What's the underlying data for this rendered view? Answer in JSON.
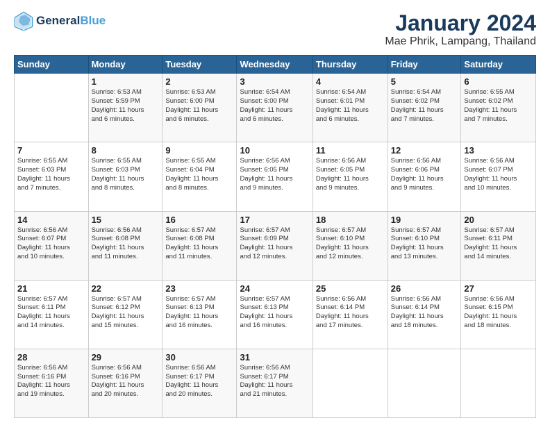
{
  "logo": {
    "line1": "General",
    "line2": "Blue"
  },
  "title": "January 2024",
  "subtitle": "Mae Phrik, Lampang, Thailand",
  "days_header": [
    "Sunday",
    "Monday",
    "Tuesday",
    "Wednesday",
    "Thursday",
    "Friday",
    "Saturday"
  ],
  "weeks": [
    [
      {
        "day": "",
        "info": ""
      },
      {
        "day": "1",
        "info": "Sunrise: 6:53 AM\nSunset: 5:59 PM\nDaylight: 11 hours\nand 6 minutes."
      },
      {
        "day": "2",
        "info": "Sunrise: 6:53 AM\nSunset: 6:00 PM\nDaylight: 11 hours\nand 6 minutes."
      },
      {
        "day": "3",
        "info": "Sunrise: 6:54 AM\nSunset: 6:00 PM\nDaylight: 11 hours\nand 6 minutes."
      },
      {
        "day": "4",
        "info": "Sunrise: 6:54 AM\nSunset: 6:01 PM\nDaylight: 11 hours\nand 6 minutes."
      },
      {
        "day": "5",
        "info": "Sunrise: 6:54 AM\nSunset: 6:02 PM\nDaylight: 11 hours\nand 7 minutes."
      },
      {
        "day": "6",
        "info": "Sunrise: 6:55 AM\nSunset: 6:02 PM\nDaylight: 11 hours\nand 7 minutes."
      }
    ],
    [
      {
        "day": "7",
        "info": "Sunrise: 6:55 AM\nSunset: 6:03 PM\nDaylight: 11 hours\nand 7 minutes."
      },
      {
        "day": "8",
        "info": "Sunrise: 6:55 AM\nSunset: 6:03 PM\nDaylight: 11 hours\nand 8 minutes."
      },
      {
        "day": "9",
        "info": "Sunrise: 6:55 AM\nSunset: 6:04 PM\nDaylight: 11 hours\nand 8 minutes."
      },
      {
        "day": "10",
        "info": "Sunrise: 6:56 AM\nSunset: 6:05 PM\nDaylight: 11 hours\nand 9 minutes."
      },
      {
        "day": "11",
        "info": "Sunrise: 6:56 AM\nSunset: 6:05 PM\nDaylight: 11 hours\nand 9 minutes."
      },
      {
        "day": "12",
        "info": "Sunrise: 6:56 AM\nSunset: 6:06 PM\nDaylight: 11 hours\nand 9 minutes."
      },
      {
        "day": "13",
        "info": "Sunrise: 6:56 AM\nSunset: 6:07 PM\nDaylight: 11 hours\nand 10 minutes."
      }
    ],
    [
      {
        "day": "14",
        "info": "Sunrise: 6:56 AM\nSunset: 6:07 PM\nDaylight: 11 hours\nand 10 minutes."
      },
      {
        "day": "15",
        "info": "Sunrise: 6:56 AM\nSunset: 6:08 PM\nDaylight: 11 hours\nand 11 minutes."
      },
      {
        "day": "16",
        "info": "Sunrise: 6:57 AM\nSunset: 6:08 PM\nDaylight: 11 hours\nand 11 minutes."
      },
      {
        "day": "17",
        "info": "Sunrise: 6:57 AM\nSunset: 6:09 PM\nDaylight: 11 hours\nand 12 minutes."
      },
      {
        "day": "18",
        "info": "Sunrise: 6:57 AM\nSunset: 6:10 PM\nDaylight: 11 hours\nand 12 minutes."
      },
      {
        "day": "19",
        "info": "Sunrise: 6:57 AM\nSunset: 6:10 PM\nDaylight: 11 hours\nand 13 minutes."
      },
      {
        "day": "20",
        "info": "Sunrise: 6:57 AM\nSunset: 6:11 PM\nDaylight: 11 hours\nand 14 minutes."
      }
    ],
    [
      {
        "day": "21",
        "info": "Sunrise: 6:57 AM\nSunset: 6:11 PM\nDaylight: 11 hours\nand 14 minutes."
      },
      {
        "day": "22",
        "info": "Sunrise: 6:57 AM\nSunset: 6:12 PM\nDaylight: 11 hours\nand 15 minutes."
      },
      {
        "day": "23",
        "info": "Sunrise: 6:57 AM\nSunset: 6:13 PM\nDaylight: 11 hours\nand 16 minutes."
      },
      {
        "day": "24",
        "info": "Sunrise: 6:57 AM\nSunset: 6:13 PM\nDaylight: 11 hours\nand 16 minutes."
      },
      {
        "day": "25",
        "info": "Sunrise: 6:56 AM\nSunset: 6:14 PM\nDaylight: 11 hours\nand 17 minutes."
      },
      {
        "day": "26",
        "info": "Sunrise: 6:56 AM\nSunset: 6:14 PM\nDaylight: 11 hours\nand 18 minutes."
      },
      {
        "day": "27",
        "info": "Sunrise: 6:56 AM\nSunset: 6:15 PM\nDaylight: 11 hours\nand 18 minutes."
      }
    ],
    [
      {
        "day": "28",
        "info": "Sunrise: 6:56 AM\nSunset: 6:16 PM\nDaylight: 11 hours\nand 19 minutes."
      },
      {
        "day": "29",
        "info": "Sunrise: 6:56 AM\nSunset: 6:16 PM\nDaylight: 11 hours\nand 20 minutes."
      },
      {
        "day": "30",
        "info": "Sunrise: 6:56 AM\nSunset: 6:17 PM\nDaylight: 11 hours\nand 20 minutes."
      },
      {
        "day": "31",
        "info": "Sunrise: 6:56 AM\nSunset: 6:17 PM\nDaylight: 11 hours\nand 21 minutes."
      },
      {
        "day": "",
        "info": ""
      },
      {
        "day": "",
        "info": ""
      },
      {
        "day": "",
        "info": ""
      }
    ]
  ]
}
